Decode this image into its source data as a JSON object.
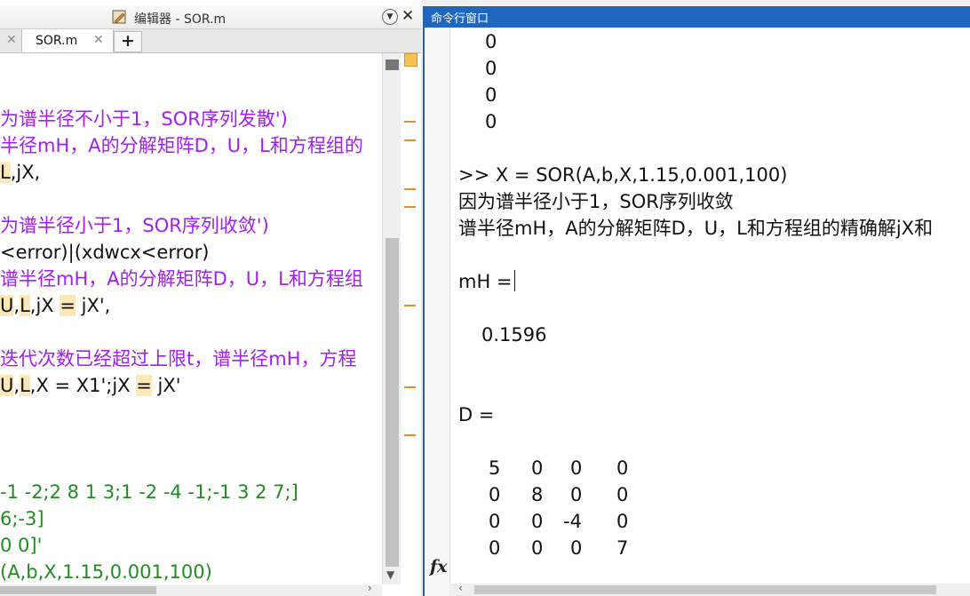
{
  "editor": {
    "title": "编辑器 - SOR.m",
    "tab_label": "SOR.m",
    "add_tab": "+",
    "close_glyph": "✕",
    "menu_glyph": "▼",
    "lines": [
      {
        "segments": [
          {
            "text": "为谱半径不小于1，SOR序列发散')",
            "cls": "purple"
          }
        ]
      },
      {
        "segments": [
          {
            "text": "半径mH，A的分解矩阵D，U，L和方程组的",
            "cls": "purple"
          }
        ]
      },
      {
        "segments": [
          {
            "text": "L",
            "cls": "black hl"
          },
          {
            "text": ",jX,",
            "cls": "black"
          }
        ]
      },
      {
        "segments": [
          {
            "text": "为谱半径小于1，SOR序列收敛')",
            "cls": "purple"
          }
        ]
      },
      {
        "segments": [
          {
            "text": "<error)|(xdwcx<error)",
            "cls": "black"
          }
        ]
      },
      {
        "segments": [
          {
            "text": "谱半径mH，A的分解矩阵D，U，L和方程组",
            "cls": "purple"
          }
        ]
      },
      {
        "segments": [
          {
            "text": "U",
            "cls": "black hl"
          },
          {
            "text": ",",
            "cls": "black"
          },
          {
            "text": "L",
            "cls": "black hl"
          },
          {
            "text": ",jX ",
            "cls": "black"
          },
          {
            "text": "=",
            "cls": "black hl"
          },
          {
            "text": " jX',",
            "cls": "black"
          }
        ]
      },
      {
        "segments": [
          {
            "text": "迭代次数已经超过上限t，谱半径mH，方程",
            "cls": "purple"
          }
        ]
      },
      {
        "segments": [
          {
            "text": "U",
            "cls": "black hl"
          },
          {
            "text": ",",
            "cls": "black"
          },
          {
            "text": "L",
            "cls": "black hl"
          },
          {
            "text": ",X = X1';jX ",
            "cls": "black"
          },
          {
            "text": "=",
            "cls": "black hl"
          },
          {
            "text": " jX'",
            "cls": "black"
          }
        ]
      },
      {
        "segments": [
          {
            "text": "-1 -2;2 8 1 3;1 -2 -4 -1;-1 3 2 7;]",
            "cls": "green"
          }
        ]
      },
      {
        "segments": [
          {
            "text": "6;-3]",
            "cls": "green"
          }
        ]
      },
      {
        "segments": [
          {
            "text": "0 0]'",
            "cls": "green"
          }
        ]
      },
      {
        "segments": [
          {
            "text": "(A,b,X,1.15,0.001,100)",
            "cls": "green"
          }
        ]
      }
    ]
  },
  "command_window": {
    "title": "命令行窗口",
    "fx_label": "fx",
    "prev_zeros": [
      "0",
      "0",
      "0",
      "0"
    ],
    "command": ">> X = SOR(A,b,X,1.15,0.001,100)",
    "msg1": "因为谱半径小于1，SOR序列收敛",
    "msg2": "谱半径mH，A的分解矩阵D，U，L和方程组的精确解jX和",
    "mh_label": "mH =",
    "mh_value": "0.1596",
    "d_label": "D =",
    "d_matrix": [
      [
        "5",
        "0",
        "0",
        "0"
      ],
      [
        "0",
        "8",
        "0",
        "0"
      ],
      [
        "0",
        "0",
        "-4",
        "0"
      ],
      [
        "0",
        "0",
        "0",
        "7"
      ]
    ]
  }
}
